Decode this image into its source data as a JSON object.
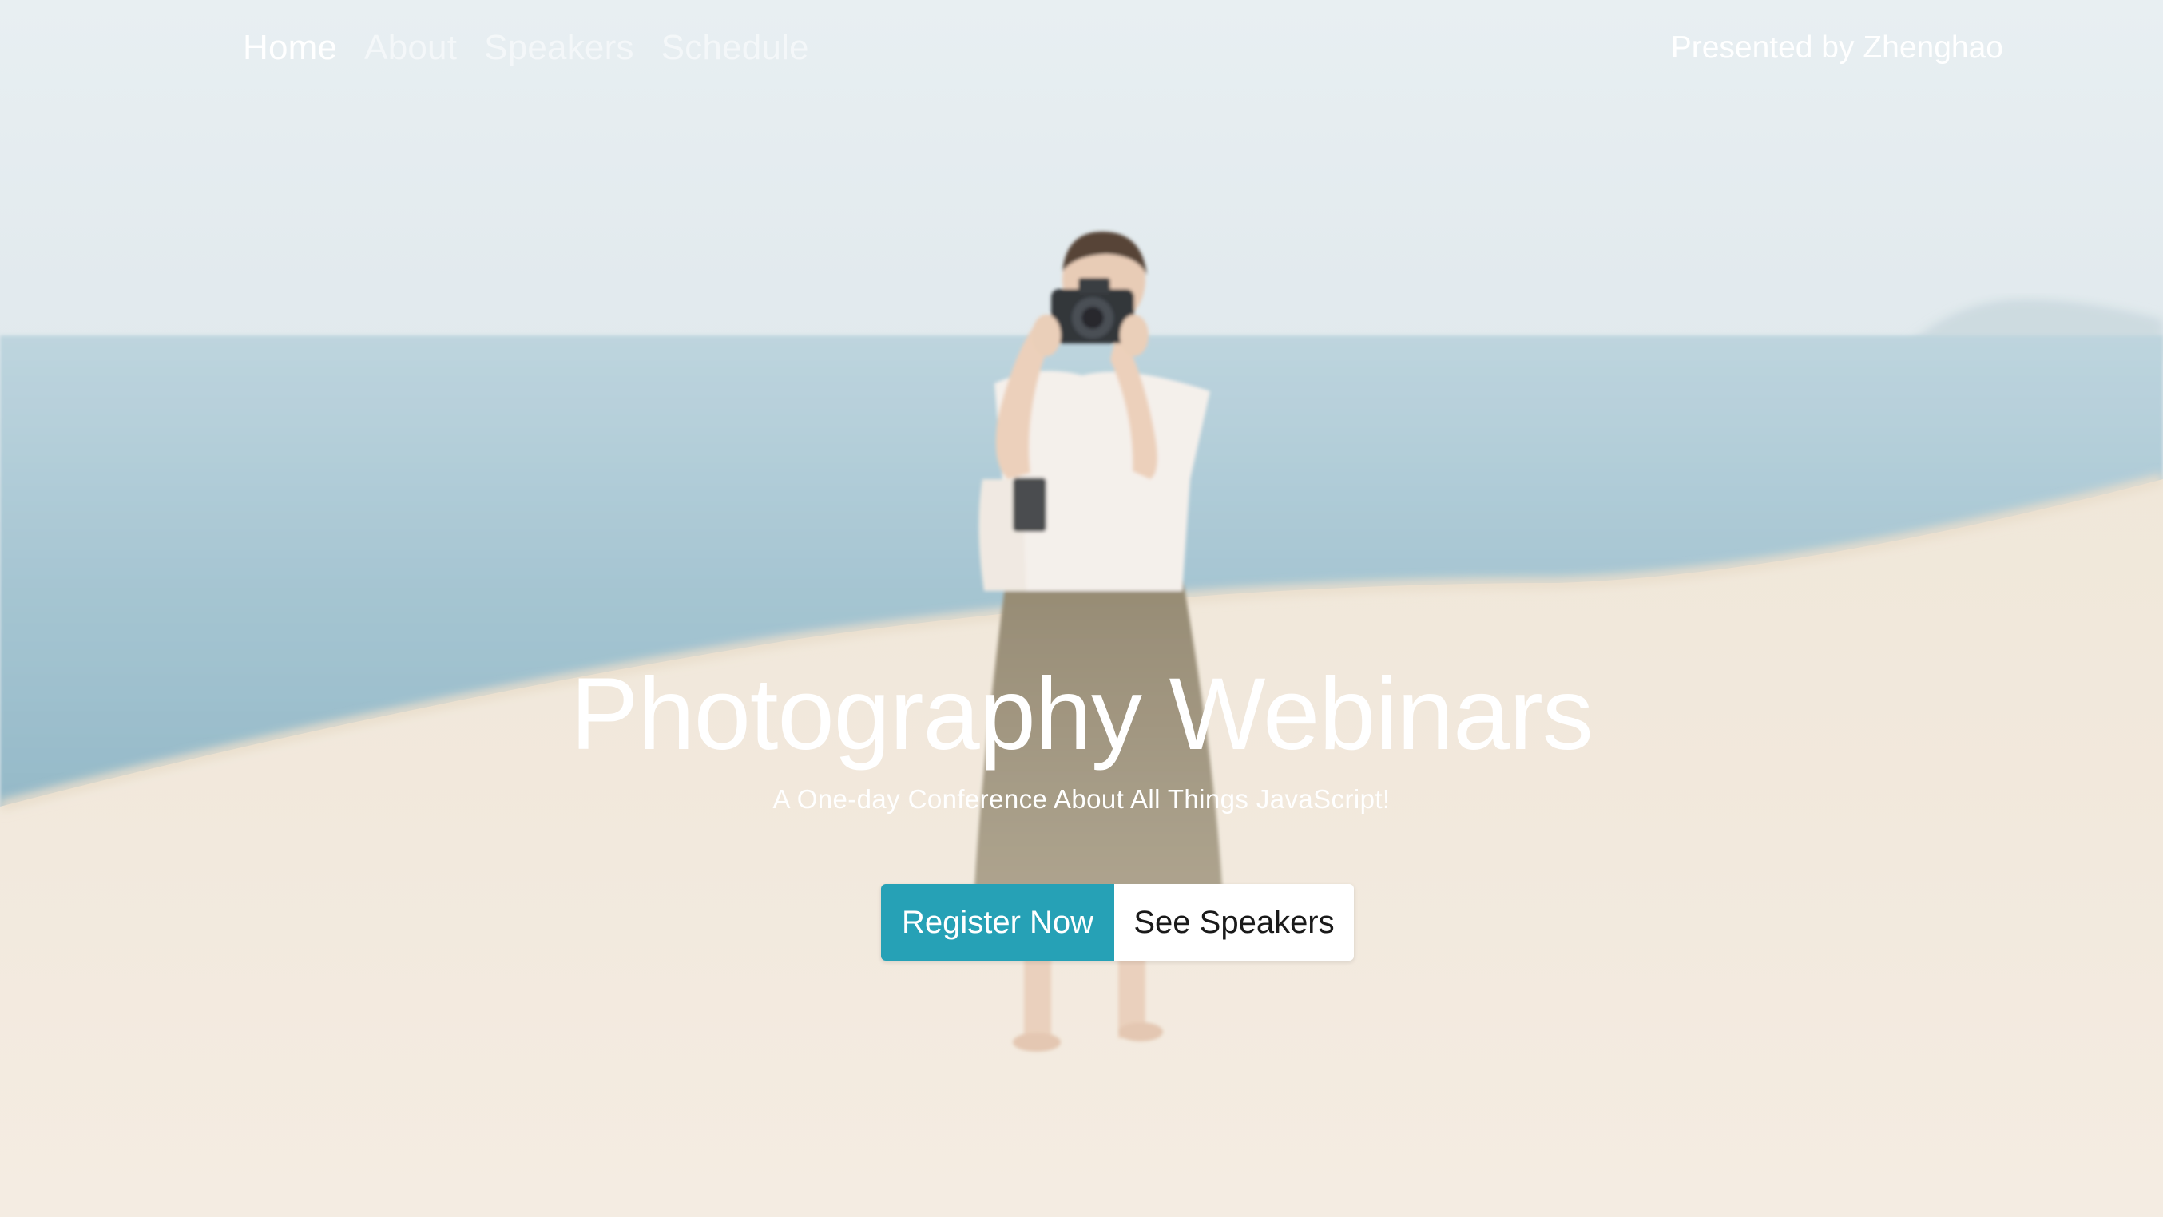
{
  "nav": {
    "links": [
      {
        "label": "Home",
        "active": true
      },
      {
        "label": "About",
        "active": false
      },
      {
        "label": "Speakers",
        "active": false
      },
      {
        "label": "Schedule",
        "active": false
      }
    ],
    "presented_by": "Presented by Zhenghao"
  },
  "hero": {
    "title": "Photography Webinars",
    "subtitle": "A One-day Conference About All Things JavaScript!",
    "primary_button": "Register Now",
    "secondary_button": "See Speakers",
    "background_image": "photographer-on-sand-dune-by-the-sea",
    "accent_color": "#26a1b6"
  }
}
